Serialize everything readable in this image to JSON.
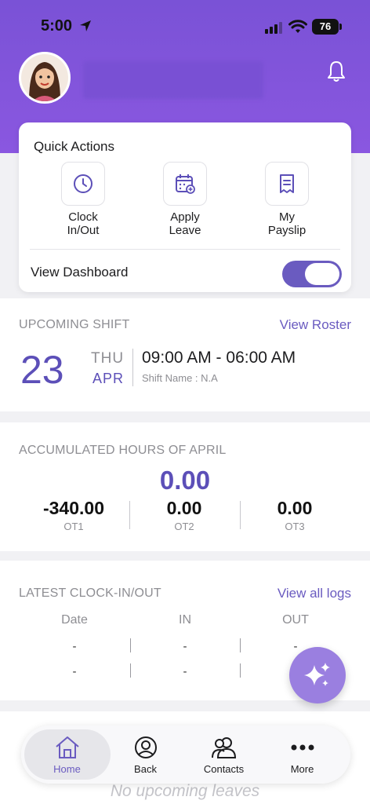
{
  "status_bar": {
    "time": "5:00",
    "battery": "76"
  },
  "quick_actions": {
    "title": "Quick Actions",
    "items": [
      {
        "label": "Clock\nIn/Out",
        "icon": "clock-icon"
      },
      {
        "label": "Apply\nLeave",
        "icon": "calendar-add-icon"
      },
      {
        "label": "My\nPayslip",
        "icon": "receipt-icon"
      }
    ],
    "view_dashboard_label": "View Dashboard",
    "view_dashboard_on": true
  },
  "upcoming_shift": {
    "title": "UPCOMING SHIFT",
    "link": "View Roster",
    "day": "23",
    "weekday": "THU",
    "month": "APR",
    "time": "09:00 AM - 06:00 AM",
    "shift_name": "Shift Name : N.A"
  },
  "accumulated": {
    "title": "ACCUMULATED HOURS OF APRIL",
    "total": "0.00",
    "columns": [
      {
        "value": "-340.00",
        "label": "OT1"
      },
      {
        "value": "0.00",
        "label": "OT2"
      },
      {
        "value": "0.00",
        "label": "OT3"
      }
    ]
  },
  "clock_logs": {
    "title": "LATEST CLOCK-IN/OUT",
    "link": "View all logs",
    "headers": [
      "Date",
      "IN",
      "OUT"
    ],
    "rows": [
      [
        "-",
        "-",
        "-"
      ],
      [
        "-",
        "-",
        "-"
      ]
    ]
  },
  "leaves": {
    "empty_text": "No upcoming leaves"
  },
  "tabbar": {
    "items": [
      {
        "label": "Home",
        "icon": "home-icon"
      },
      {
        "label": "Back",
        "icon": "user-icon"
      },
      {
        "label": "Contacts",
        "icon": "contacts-icon"
      },
      {
        "label": "More",
        "icon": "more-icon"
      }
    ]
  },
  "colors": {
    "accent": "#6a5bc0",
    "header": "#8a57e0"
  }
}
